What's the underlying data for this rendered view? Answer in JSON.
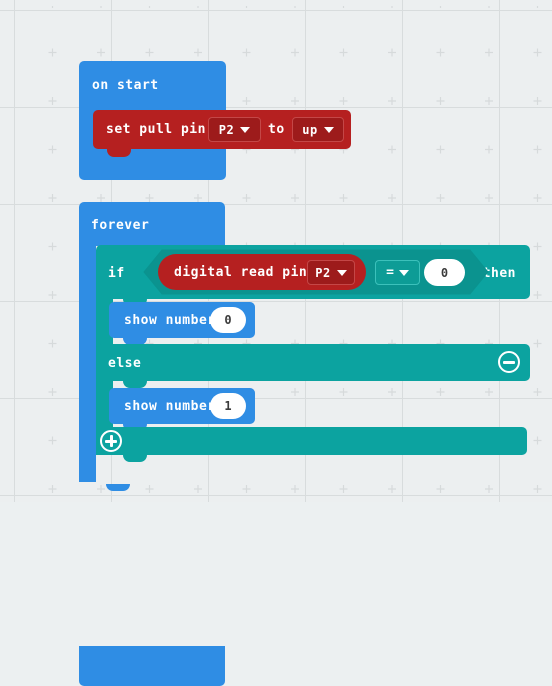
{
  "app": {
    "name": "MakeCode Blocks Editor",
    "canvas_background": "#eceff0",
    "grid_marker": "plus-cross"
  },
  "palette": {
    "event_blue": "#2f8de4",
    "pins_red": "#b52020",
    "logic_teal": "#0ca3a0",
    "field_white": "#ffffff",
    "text_white": "#ffffff"
  },
  "blocks": {
    "on_start": {
      "label": "on start",
      "color": "#2f8de4",
      "children": [
        {
          "type": "set-pull-pin",
          "label_prefix": "set pull pin",
          "pin_value": "P2",
          "label_middle": "to",
          "mode_value": "up",
          "color": "#b52020"
        }
      ]
    },
    "forever": {
      "label": "forever",
      "color": "#2f8de4",
      "if_block": {
        "if_label": "if",
        "then_label": "then",
        "else_label": "else",
        "color": "#0ca3a0",
        "condition": {
          "reporter": {
            "label": "digital read pin",
            "pin_value": "P2",
            "color": "#b52020"
          },
          "operator": "=",
          "compare_value": "0"
        },
        "then_body": [
          {
            "type": "show-number",
            "label": "show number",
            "value": "0",
            "color": "#2f8de4"
          }
        ],
        "else_body": [
          {
            "type": "show-number",
            "label": "show number",
            "value": "1",
            "color": "#2f8de4"
          }
        ],
        "mutator_remove_icon": "minus-circle-icon",
        "mutator_add_icon": "plus-circle-icon"
      }
    }
  }
}
